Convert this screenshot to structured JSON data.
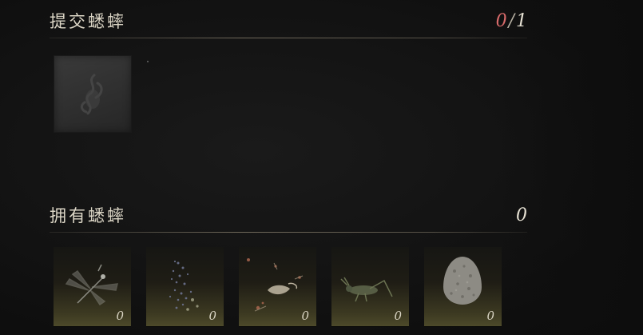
{
  "submit_section": {
    "title": "提交蟋蟀",
    "count_current": "0",
    "count_separator": "/",
    "count_total": "1",
    "slot_icon": "cricket-silhouette-icon"
  },
  "owned_section": {
    "title": "拥有蟋蟀",
    "count": "0"
  },
  "inventory": [
    {
      "icon": "dragonfly-icon",
      "quantity": "0"
    },
    {
      "icon": "firefly-swarm-icon",
      "quantity": "0"
    },
    {
      "icon": "moths-icon",
      "quantity": "0"
    },
    {
      "icon": "grasshopper-icon",
      "quantity": "0"
    },
    {
      "icon": "wasp-nest-icon",
      "quantity": "0"
    }
  ],
  "colors": {
    "background": "#121212",
    "counter_current": "#d96b6b",
    "text": "#dcd6c6"
  }
}
